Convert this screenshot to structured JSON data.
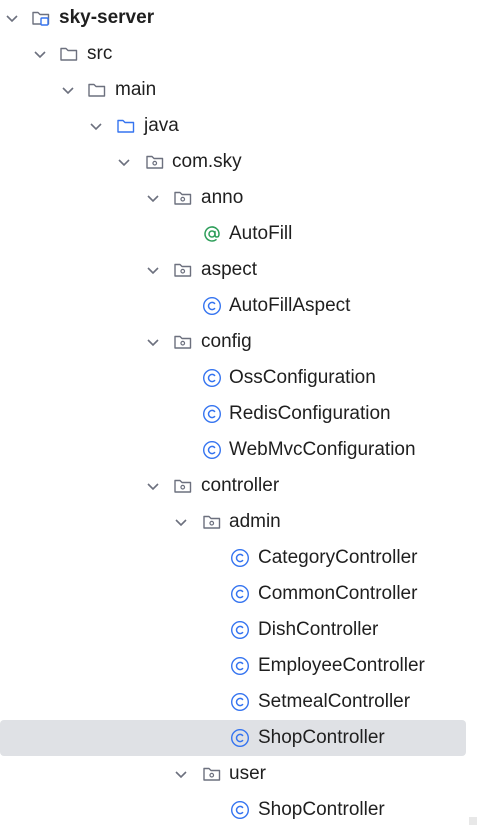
{
  "project_tree": {
    "items": [
      {
        "label": "sky-server",
        "icon": "module-folder-icon",
        "expanded": true,
        "bold": true
      },
      {
        "label": "src",
        "icon": "folder-icon",
        "expanded": true
      },
      {
        "label": "main",
        "icon": "folder-icon",
        "expanded": true
      },
      {
        "label": "java",
        "icon": "source-root-folder-icon",
        "expanded": true
      },
      {
        "label": "com.sky",
        "icon": "package-icon",
        "expanded": true
      },
      {
        "label": "anno",
        "icon": "package-icon",
        "expanded": true
      },
      {
        "label": "AutoFill",
        "icon": "annotation-icon"
      },
      {
        "label": "aspect",
        "icon": "package-icon",
        "expanded": true
      },
      {
        "label": "AutoFillAspect",
        "icon": "class-icon"
      },
      {
        "label": "config",
        "icon": "package-icon",
        "expanded": true
      },
      {
        "label": "OssConfiguration",
        "icon": "class-icon"
      },
      {
        "label": "RedisConfiguration",
        "icon": "class-icon"
      },
      {
        "label": "WebMvcConfiguration",
        "icon": "class-icon"
      },
      {
        "label": "controller",
        "icon": "package-icon",
        "expanded": true
      },
      {
        "label": "admin",
        "icon": "package-icon",
        "expanded": true
      },
      {
        "label": "CategoryController",
        "icon": "class-icon"
      },
      {
        "label": "CommonController",
        "icon": "class-icon"
      },
      {
        "label": "DishController",
        "icon": "class-icon"
      },
      {
        "label": "EmployeeController",
        "icon": "class-icon"
      },
      {
        "label": "SetmealController",
        "icon": "class-icon"
      },
      {
        "label": "ShopController",
        "icon": "class-icon",
        "selected": true
      },
      {
        "label": "user",
        "icon": "package-icon",
        "expanded": true
      },
      {
        "label": "ShopController",
        "icon": "class-icon"
      }
    ]
  },
  "colors": {
    "selection": "#dfe1e5",
    "class_icon": "#3574f0",
    "annotation_icon": "#2e9e5a",
    "folder_icon": "#6c707e",
    "source_root_icon": "#3574f0"
  }
}
